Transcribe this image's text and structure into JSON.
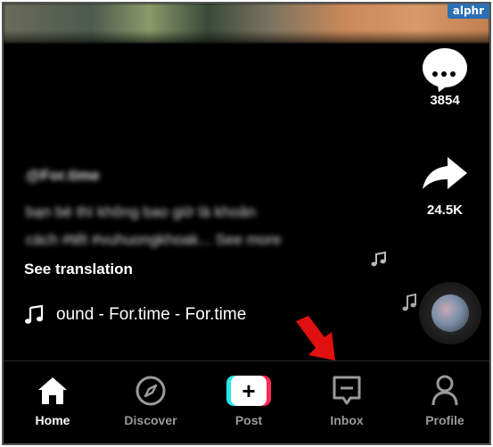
{
  "watermark": "alphr",
  "actions": {
    "comments_count": "3854",
    "shares_count": "24.5K"
  },
  "caption": {
    "username": "@For.time",
    "line1": "bạn bè thì không bao giờ là khoản",
    "line2": "cách #tết #vuhuongkhoak... See more",
    "see_translation": "See translation"
  },
  "sound": {
    "text": "ound - For.time - For.time"
  },
  "nav": {
    "home": "Home",
    "discover": "Discover",
    "post": "Post",
    "inbox": "Inbox",
    "profile": "Profile"
  },
  "colors": {
    "post_cyan": "#29e6e6",
    "post_red": "#ff2a57",
    "arrow_red": "#e01010",
    "inactive_nav": "#9a9a9a"
  }
}
